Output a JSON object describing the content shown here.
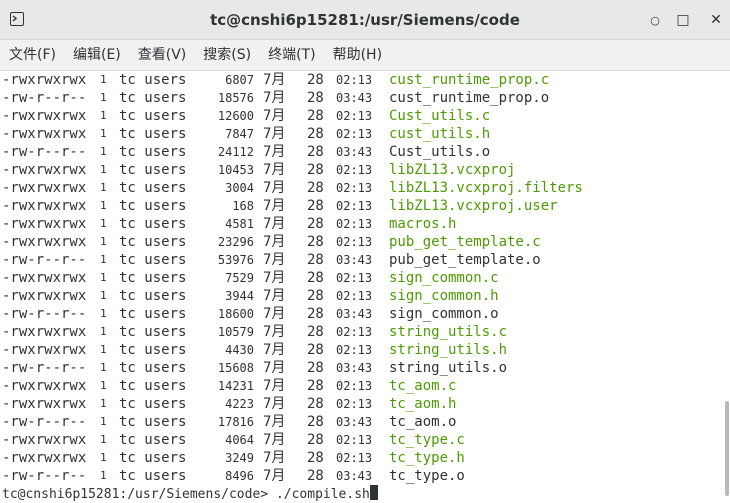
{
  "window": {
    "title": "tc@cnshi6p15281:/usr/Siemens/code",
    "minimize_glyph": "○",
    "maximize_glyph": "□",
    "close_glyph": "✕"
  },
  "menu": [
    "文件(F)",
    "编辑(E)",
    "查看(V)",
    "搜索(S)",
    "终端(T)",
    "帮助(H)"
  ],
  "colors": {
    "exec": "#4e9a06",
    "normal": "#2e3436"
  },
  "listing": [
    {
      "perm": "-rwxrwxrwx",
      "links": "1",
      "owner": "tc users",
      "size": "6807",
      "month": "7月",
      "day": "28",
      "time": "02:13",
      "name": "cust_runtime_prop.c",
      "exec": true
    },
    {
      "perm": "-rw-r--r--",
      "links": "1",
      "owner": "tc users",
      "size": "18576",
      "month": "7月",
      "day": "28",
      "time": "03:43",
      "name": "cust_runtime_prop.o",
      "exec": false
    },
    {
      "perm": "-rwxrwxrwx",
      "links": "1",
      "owner": "tc users",
      "size": "12600",
      "month": "7月",
      "day": "28",
      "time": "02:13",
      "name": "Cust_utils.c",
      "exec": true
    },
    {
      "perm": "-rwxrwxrwx",
      "links": "1",
      "owner": "tc users",
      "size": "7847",
      "month": "7月",
      "day": "28",
      "time": "02:13",
      "name": "cust_utils.h",
      "exec": true
    },
    {
      "perm": "-rw-r--r--",
      "links": "1",
      "owner": "tc users",
      "size": "24112",
      "month": "7月",
      "day": "28",
      "time": "03:43",
      "name": "Cust_utils.o",
      "exec": false
    },
    {
      "perm": "-rwxrwxrwx",
      "links": "1",
      "owner": "tc users",
      "size": "10453",
      "month": "7月",
      "day": "28",
      "time": "02:13",
      "name": "libZL13.vcxproj",
      "exec": true
    },
    {
      "perm": "-rwxrwxrwx",
      "links": "1",
      "owner": "tc users",
      "size": "3004",
      "month": "7月",
      "day": "28",
      "time": "02:13",
      "name": "libZL13.vcxproj.filters",
      "exec": true
    },
    {
      "perm": "-rwxrwxrwx",
      "links": "1",
      "owner": "tc users",
      "size": "168",
      "month": "7月",
      "day": "28",
      "time": "02:13",
      "name": "libZL13.vcxproj.user",
      "exec": true
    },
    {
      "perm": "-rwxrwxrwx",
      "links": "1",
      "owner": "tc users",
      "size": "4581",
      "month": "7月",
      "day": "28",
      "time": "02:13",
      "name": "macros.h",
      "exec": true
    },
    {
      "perm": "-rwxrwxrwx",
      "links": "1",
      "owner": "tc users",
      "size": "23296",
      "month": "7月",
      "day": "28",
      "time": "02:13",
      "name": "pub_get_template.c",
      "exec": true
    },
    {
      "perm": "-rw-r--r--",
      "links": "1",
      "owner": "tc users",
      "size": "53976",
      "month": "7月",
      "day": "28",
      "time": "03:43",
      "name": "pub_get_template.o",
      "exec": false
    },
    {
      "perm": "-rwxrwxrwx",
      "links": "1",
      "owner": "tc users",
      "size": "7529",
      "month": "7月",
      "day": "28",
      "time": "02:13",
      "name": "sign_common.c",
      "exec": true
    },
    {
      "perm": "-rwxrwxrwx",
      "links": "1",
      "owner": "tc users",
      "size": "3944",
      "month": "7月",
      "day": "28",
      "time": "02:13",
      "name": "sign_common.h",
      "exec": true
    },
    {
      "perm": "-rw-r--r--",
      "links": "1",
      "owner": "tc users",
      "size": "18600",
      "month": "7月",
      "day": "28",
      "time": "03:43",
      "name": "sign_common.o",
      "exec": false
    },
    {
      "perm": "-rwxrwxrwx",
      "links": "1",
      "owner": "tc users",
      "size": "10579",
      "month": "7月",
      "day": "28",
      "time": "02:13",
      "name": "string_utils.c",
      "exec": true
    },
    {
      "perm": "-rwxrwxrwx",
      "links": "1",
      "owner": "tc users",
      "size": "4430",
      "month": "7月",
      "day": "28",
      "time": "02:13",
      "name": "string_utils.h",
      "exec": true
    },
    {
      "perm": "-rw-r--r--",
      "links": "1",
      "owner": "tc users",
      "size": "15608",
      "month": "7月",
      "day": "28",
      "time": "03:43",
      "name": "string_utils.o",
      "exec": false
    },
    {
      "perm": "-rwxrwxrwx",
      "links": "1",
      "owner": "tc users",
      "size": "14231",
      "month": "7月",
      "day": "28",
      "time": "02:13",
      "name": "tc_aom.c",
      "exec": true
    },
    {
      "perm": "-rwxrwxrwx",
      "links": "1",
      "owner": "tc users",
      "size": "4223",
      "month": "7月",
      "day": "28",
      "time": "02:13",
      "name": "tc_aom.h",
      "exec": true
    },
    {
      "perm": "-rw-r--r--",
      "links": "1",
      "owner": "tc users",
      "size": "17816",
      "month": "7月",
      "day": "28",
      "time": "03:43",
      "name": "tc_aom.o",
      "exec": false
    },
    {
      "perm": "-rwxrwxrwx",
      "links": "1",
      "owner": "tc users",
      "size": "4064",
      "month": "7月",
      "day": "28",
      "time": "02:13",
      "name": "tc_type.c",
      "exec": true
    },
    {
      "perm": "-rwxrwxrwx",
      "links": "1",
      "owner": "tc users",
      "size": "3249",
      "month": "7月",
      "day": "28",
      "time": "02:13",
      "name": "tc_type.h",
      "exec": true
    },
    {
      "perm": "-rw-r--r--",
      "links": "1",
      "owner": "tc users",
      "size": "8496",
      "month": "7月",
      "day": "28",
      "time": "03:43",
      "name": "tc_type.o",
      "exec": false
    }
  ],
  "prompt": {
    "text": "tc@cnshi6p15281:/usr/Siemens/code> ",
    "command": "./compile.sh"
  }
}
